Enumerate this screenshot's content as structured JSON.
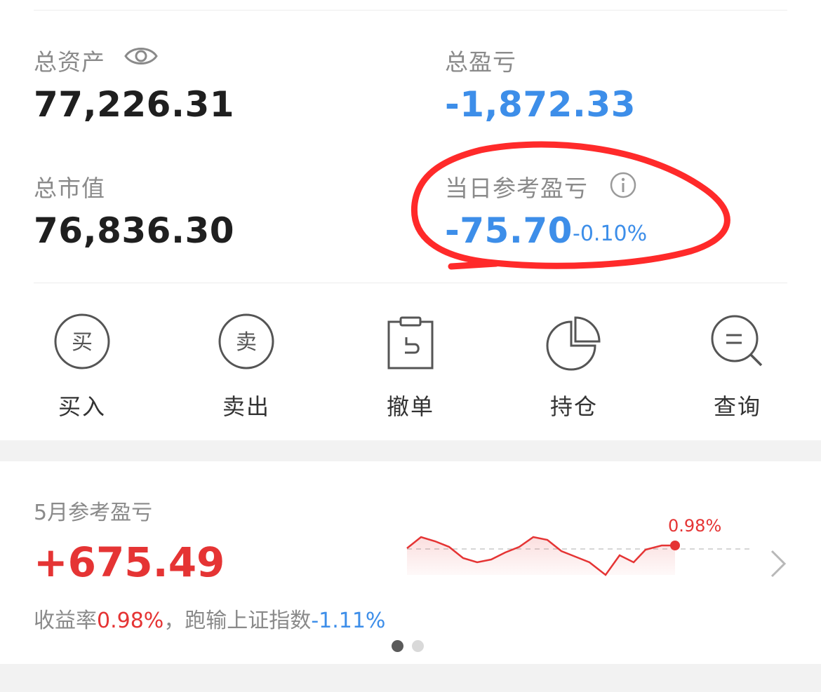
{
  "summary": {
    "total_assets_label": "总资产",
    "total_assets_value": "77,226.31",
    "total_pnl_label": "总盈亏",
    "total_pnl_value": "-1,872.33",
    "market_value_label": "总市值",
    "market_value_value": "76,836.30",
    "daily_ref_pnl_label": "当日参考盈亏",
    "daily_ref_pnl_value": "-75.70",
    "daily_ref_pnl_pct": "-0.10%"
  },
  "actions": [
    {
      "icon_text": "买",
      "label": "买入"
    },
    {
      "icon_text": "卖",
      "label": "卖出"
    },
    {
      "label": "撤单"
    },
    {
      "label": "持仓"
    },
    {
      "label": "查询"
    }
  ],
  "monthly": {
    "title": "5月参考盈亏",
    "value": "+675.49",
    "note_prefix": "收益率",
    "return_pct": "0.98%",
    "note_mid": "，跑输上证指数",
    "vs_index_pct": "-1.11%",
    "sparkline_end_label": "0.98%"
  },
  "colors": {
    "loss_blue": "#3d8ee9",
    "gain_red": "#e53434",
    "annotation_red": "#ff2a2a"
  },
  "icons": [
    "eye-icon",
    "info-icon",
    "buy-icon",
    "sell-icon",
    "cancel-order-icon",
    "holdings-icon",
    "query-icon",
    "chevron-right-icon"
  ]
}
